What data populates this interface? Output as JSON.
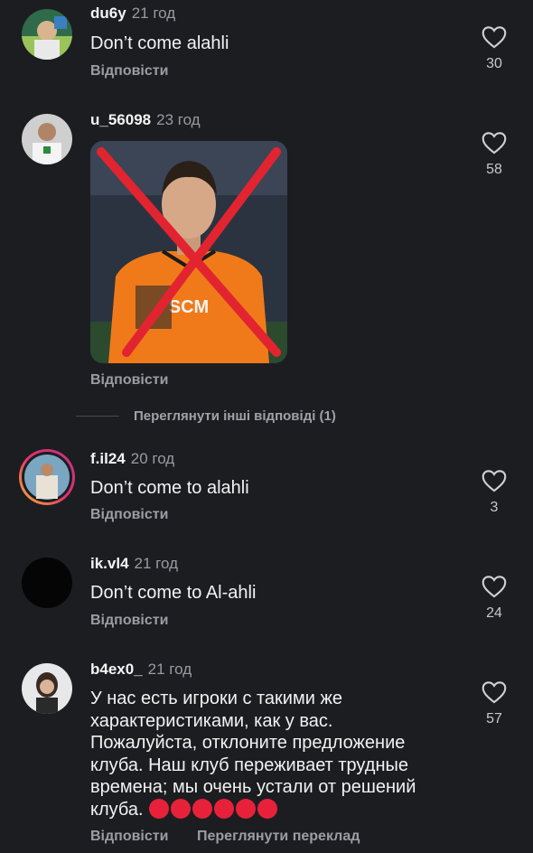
{
  "comments": [
    {
      "user": "du6y",
      "time": "21 год",
      "text": "Don’t come alahli",
      "reply": "Відповісти",
      "likes": "30"
    },
    {
      "user": "u_56098",
      "time": "23 год",
      "reply": "Відповісти",
      "likes": "58",
      "more_replies": "Переглянути інші відповіді (1)"
    },
    {
      "user": "f.il24",
      "time": "20 год",
      "text": "Don’t come to alahli",
      "reply": "Відповісти",
      "likes": "3"
    },
    {
      "user": "ik.vl4",
      "time": "21 год",
      "text": "Don’t come to Al-ahli",
      "reply": "Відповісти",
      "likes": "24"
    },
    {
      "user": "b4ex0_",
      "time": "21 год",
      "text_lines": [
        "У нас есть игроки с такими же",
        "характеристиками, как у вас.",
        "Пожалуйста, отклоните предложение",
        "клуба. Наш клуб переживает трудные",
        "времена; мы очень устали от решений",
        "клуба."
      ],
      "reply": "Відповісти",
      "translate": "Переглянути переклад",
      "likes": "57"
    }
  ],
  "colors": {
    "background": "#1c1d21",
    "accent_red": "#e8213a",
    "shirt_orange": "#f07a1a"
  },
  "icons": {
    "like": "heart-outline-icon"
  },
  "image_text": {
    "sponsor": "SCM"
  }
}
